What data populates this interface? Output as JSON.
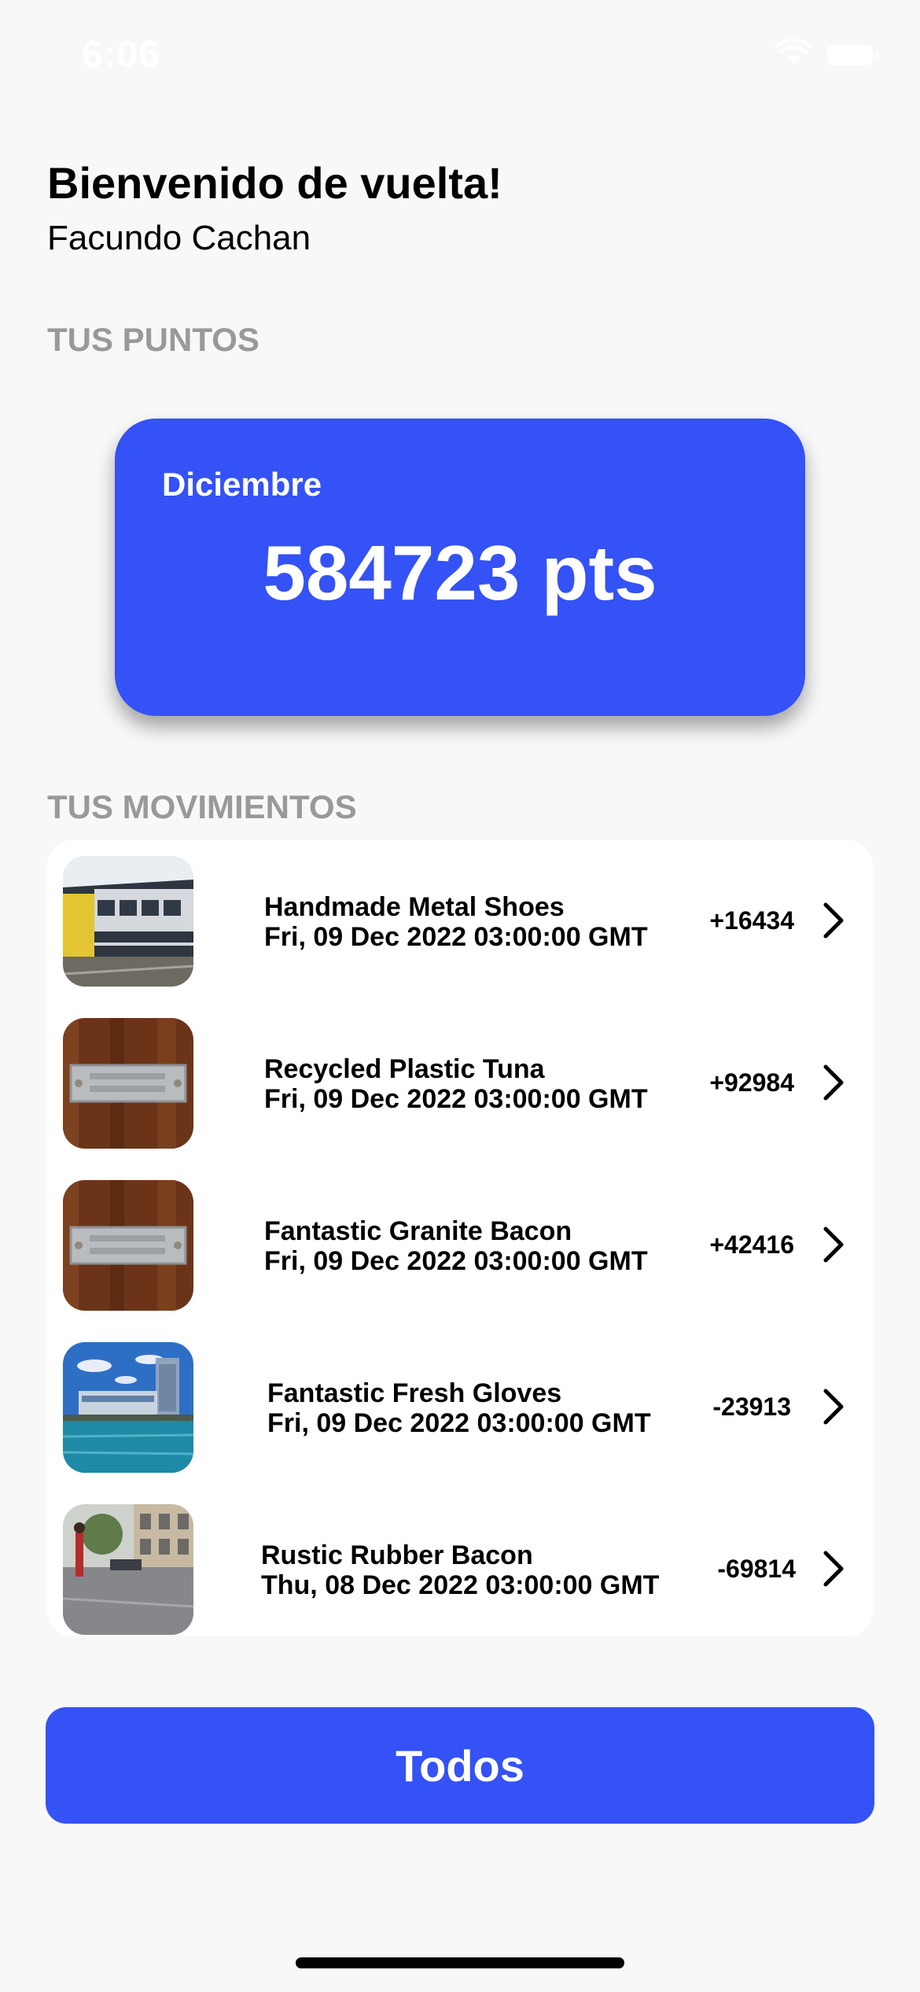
{
  "status": {
    "time": "6:06",
    "icons": [
      "wifi-icon",
      "battery-icon"
    ]
  },
  "header": {
    "greeting": "Bienvenido de vuelta!",
    "user_name": "Facundo Cachan"
  },
  "points": {
    "section_label": "TUS PUNTOS",
    "month": "Diciembre",
    "value": "584723 pts"
  },
  "movements": {
    "section_label": "TUS MOVIMIENTOS",
    "items": [
      {
        "title": "Handmade Metal Shoes",
        "date": "Fri, 09 Dec 2022 03:00:00 GMT",
        "amount": "+16434",
        "image": "train-photo"
      },
      {
        "title": "Recycled Plastic Tuna",
        "date": "Fri, 09 Dec 2022 03:00:00 GMT",
        "amount": "+92984",
        "image": "metal-plate-photo"
      },
      {
        "title": "Fantastic Granite Bacon",
        "date": "Fri, 09 Dec 2022 03:00:00 GMT",
        "amount": "+42416",
        "image": "metal-plate-photo"
      },
      {
        "title": "Fantastic Fresh Gloves",
        "date": "Fri, 09 Dec 2022 03:00:00 GMT",
        "amount": "-23913",
        "image": "waterfront-city-photo"
      },
      {
        "title": "Rustic Rubber Bacon",
        "date": "Thu, 08 Dec 2022 03:00:00 GMT",
        "amount": "-69814",
        "image": "rainy-street-photo"
      }
    ]
  },
  "actions": {
    "all_label": "Todos"
  },
  "colors": {
    "accent": "#3452f5",
    "section_label": "#999999",
    "background": "#f8f8f8"
  }
}
